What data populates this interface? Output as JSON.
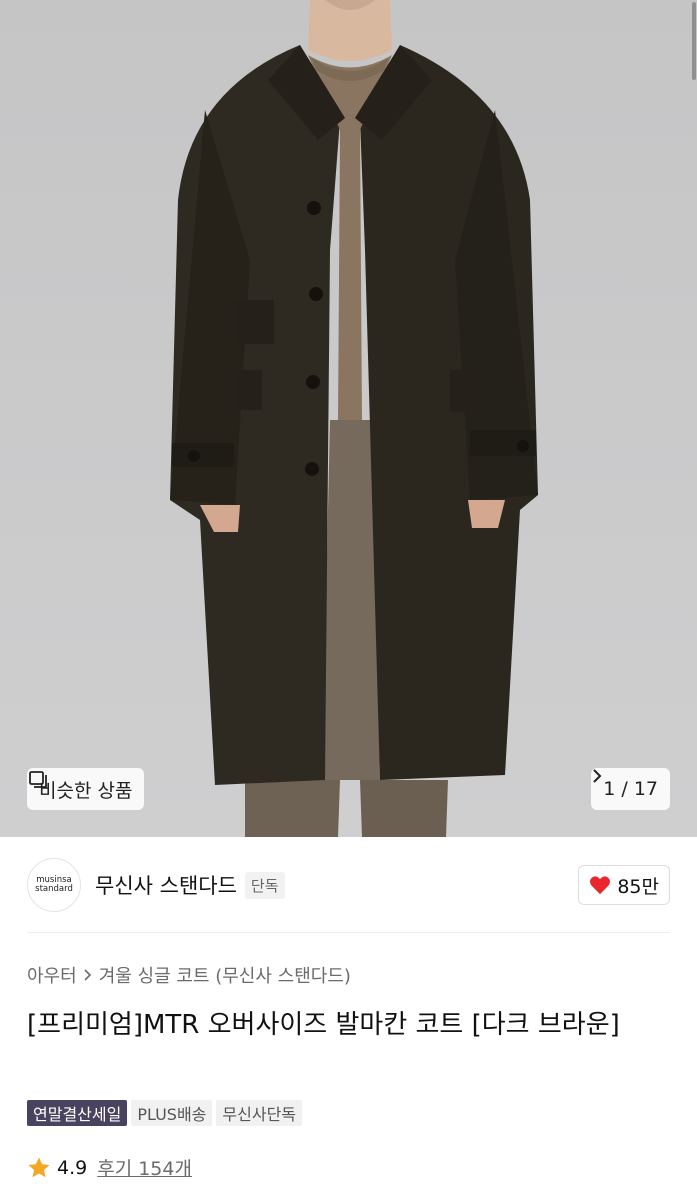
{
  "gallery": {
    "similar_label": "비슷한 상품",
    "pager_label": "1 / 17",
    "icons": {
      "similar": "similar-products-icon",
      "next": "chevron-right-icon"
    },
    "colors": {
      "background": "#c8c8c9",
      "coat": "#2e2a22",
      "sweater": "#8a7660",
      "trousers": "#6d6253"
    }
  },
  "brand": {
    "logo_line1": "musinsa",
    "logo_line2": "standard",
    "name": "무신사 스탠다드",
    "badge": "단독"
  },
  "like": {
    "count": "85만",
    "icon": "heart-icon",
    "color": "#e8262c"
  },
  "breadcrumb": {
    "items": [
      "아우터",
      "겨울 싱글 코트 (무신사 스탠다드)"
    ]
  },
  "product": {
    "title": "[프리미엄]MTR 오버사이즈 발마칸 코트 [다크 브라운]",
    "tags": [
      "연말결산세일",
      "PLUS배송",
      "무신사단독"
    ]
  },
  "rating": {
    "score": "4.9",
    "reviews": "후기 154개",
    "star_color": "#f5a623"
  }
}
